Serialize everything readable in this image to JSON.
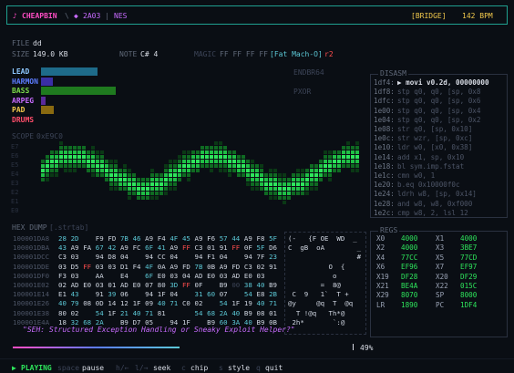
{
  "header": {
    "note_glyph": "♪",
    "app_name": "CHEAPBIN",
    "sep1": "\\",
    "chip_glyph": "◆",
    "chip": "2A03",
    "sep2": "|",
    "system": "NES",
    "mode": "[BRIDGE]",
    "bpm": "142 BPM"
  },
  "file": {
    "file_label": "FILE",
    "file_value": "dd",
    "size_label": "SIZE",
    "size_value": "149.0 KB",
    "note_label": "NOTE",
    "note_value": "C# 4",
    "magic_label": "MAGIC",
    "magic_value": "FF FF FF FF",
    "magic_desc": "[Fat Mach-O]",
    "magic_rev": "r2"
  },
  "channels": [
    {
      "name": "LEAD",
      "color": "#8ec8ff",
      "bar_color": "#1e6b8a",
      "level": 0.62
    },
    {
      "name": "HARMON",
      "color": "#5c7cff",
      "bar_color": "#3a2ea6",
      "level": 0.13
    },
    {
      "name": "BASS",
      "color": "#7cdc4a",
      "bar_color": "#1f7a1f",
      "level": 0.82
    },
    {
      "name": "ARPEG",
      "color": "#c86bff",
      "bar_color": "#5a2a9a",
      "level": 0.05
    },
    {
      "name": "PAD",
      "color": "#f2c94c",
      "bar_color": "#8a6a10",
      "level": 0.14
    },
    {
      "name": "DRUMS",
      "color": "#ff4d6a",
      "bar_color": "#000000",
      "level": 0.0
    }
  ],
  "effects": [
    "ENDBR64",
    "PXOR"
  ],
  "scope": {
    "label": "SCOPE",
    "value": "0xE9C0",
    "lanes": [
      "E7",
      "E6",
      "E5",
      "E4",
      "E3",
      "E2",
      "E1",
      "E0"
    ]
  },
  "disasm": {
    "title": "DISASM",
    "rows": [
      {
        "addr": "1df4:",
        "ins": "▶ movi v0.2d, 00000000",
        "active": true
      },
      {
        "addr": "1df8:",
        "ins": "stp q0, q0, [sp, 0x8",
        "active": false
      },
      {
        "addr": "1dfc:",
        "ins": "stp q0, q0, [sp, 0x6",
        "active": false
      },
      {
        "addr": "1e00:",
        "ins": "stp q0, q0, [sp, 0x4",
        "active": false
      },
      {
        "addr": "1e04:",
        "ins": "stp q0, q0, [sp, 0x2",
        "active": false
      },
      {
        "addr": "1e08:",
        "ins": "str q0, [sp, 0x10]",
        "active": false
      },
      {
        "addr": "1e0c:",
        "ins": "str wzr, [sp, 0xc]",
        "active": false
      },
      {
        "addr": "1e10:",
        "ins": "ldr w0, [x0, 0x38]",
        "active": false
      },
      {
        "addr": "1e14:",
        "ins": "add x1, sp, 0x10",
        "active": false
      },
      {
        "addr": "1e18:",
        "ins": "bl sym.imp.fstat",
        "active": false
      },
      {
        "addr": "1e1c:",
        "ins": "cmn w0, 1",
        "active": false
      },
      {
        "addr": "1e20:",
        "ins": "b.eq 0x10000f0c",
        "active": false
      },
      {
        "addr": "1e24:",
        "ins": "ldrh w8, [sp, 0x14]",
        "active": false
      },
      {
        "addr": "1e28:",
        "ins": "and w8, w8, 0xf000",
        "active": false
      },
      {
        "addr": "1e2c:",
        "ins": "cmp w8, 2, lsl 12",
        "active": false
      }
    ]
  },
  "hexdump": {
    "label": "HEX DUMP",
    "value": "[.strtab]",
    "rows": [
      {
        "addr": "100001DA8",
        "bytes": [
          "28",
          "2D",
          "",
          "F9",
          "FD",
          "7B",
          "46",
          "A9",
          "F4",
          "4F",
          "45",
          "A9",
          "F6",
          "57",
          "44",
          "A9",
          "F8",
          "5F"
        ],
        "ascii": "(-   {F OE  WD  _"
      },
      {
        "addr": "100001DBA",
        "bytes": [
          "43",
          "A9",
          "FA",
          "67",
          "42",
          "A9",
          "FC",
          "6F",
          "41",
          "A9",
          "FF",
          "C3",
          "01",
          "91",
          "FF",
          "0F",
          "5F",
          "D6"
        ],
        "ascii": "C  gB  oA        _"
      },
      {
        "addr": "100001DCC",
        "bytes": [
          "C3",
          "03",
          "",
          "94",
          "D8",
          "04",
          "",
          "94",
          "CC",
          "04",
          "",
          "94",
          "F1",
          "04",
          "",
          "94",
          "7F",
          "23"
        ],
        "ascii": "                 #"
      },
      {
        "addr": "100001DDE",
        "bytes": [
          "03",
          "D5",
          "FF",
          "03",
          "03",
          "D1",
          "F4",
          "4F",
          "0A",
          "A9",
          "FD",
          "7B",
          "0B",
          "A9",
          "FD",
          "C3",
          "02",
          "91"
        ],
        "ascii": "          O  {"
      },
      {
        "addr": "100001DF0",
        "bytes": [
          "F3",
          "03",
          "",
          "AA",
          "",
          "E4",
          "",
          "6F",
          "E0",
          "03",
          "04",
          "AD",
          "E0",
          "03",
          "AD",
          "E0",
          "03"
        ],
        "ascii": "           o"
      },
      {
        "addr": "100001E02",
        "bytes": [
          "02",
          "AD",
          "E0",
          "03",
          "01",
          "AD",
          "E0",
          "07",
          "80",
          "3D",
          "FF",
          "0F",
          "",
          "B9",
          "00",
          "38",
          "40",
          "B9"
        ],
        "ascii": "        =  8@"
      },
      {
        "addr": "100001E14",
        "bytes": [
          "E1",
          "43",
          "",
          "91",
          "39",
          "06",
          "",
          "94",
          "1F",
          "04",
          "",
          "31",
          "60",
          "07",
          "",
          "54",
          "E8",
          "2B"
        ],
        "ascii": " C  9   1`  T +"
      },
      {
        "addr": "100001E26",
        "bytes": [
          "40",
          "79",
          "08",
          "0D",
          "14",
          "12",
          "1F",
          "09",
          "40",
          "71",
          "C0",
          "02",
          "",
          "54",
          "1F",
          "19",
          "40",
          "71"
        ],
        "ascii": "@y     @q  T  @q"
      },
      {
        "addr": "100001E38",
        "bytes": [
          "80",
          "02",
          "",
          "54",
          "1F",
          "21",
          "40",
          "71",
          "81",
          "",
          "",
          "54",
          "68",
          "2A",
          "40",
          "B9",
          "08",
          "01"
        ],
        "ascii": "  T !@q   Th*@"
      },
      {
        "addr": "100001E4A",
        "bytes": [
          "18",
          "32",
          "68",
          "2A",
          "",
          "B9",
          "D7",
          "05",
          "",
          "94",
          "1F",
          "",
          "B9",
          "60",
          "3A",
          "40",
          "B9",
          "0B"
        ],
        "ascii": " 2h*       `:@"
      }
    ]
  },
  "regs": {
    "title": "REGS",
    "rows": [
      [
        {
          "name": "X0",
          "value": "4000"
        },
        {
          "name": "X1",
          "value": "4000"
        }
      ],
      [
        {
          "name": "X2",
          "value": "4000"
        },
        {
          "name": "X3",
          "value": "3BE7"
        }
      ],
      [
        {
          "name": "X4",
          "value": "77CC"
        },
        {
          "name": "X5",
          "value": "77CD"
        }
      ],
      [
        {
          "name": "X6",
          "value": "EF96"
        },
        {
          "name": "X7",
          "value": "EF97"
        }
      ],
      [
        {
          "name": "X19",
          "value": "DF28"
        },
        {
          "name": "X20",
          "value": "DF29"
        }
      ],
      [
        {
          "name": "X21",
          "value": "BE4A"
        },
        {
          "name": "X22",
          "value": "015C"
        }
      ],
      [
        {
          "name": "X29",
          "value": "8070"
        },
        {
          "name": "SP",
          "value": "8000"
        }
      ],
      [
        {
          "name": "LR",
          "value": "1890"
        },
        {
          "name": "PC",
          "value": "1DF4"
        }
      ]
    ]
  },
  "lyric": "\"SEH: Structured Exception Handling or Sneaky Exploit Helper?\"",
  "progress": {
    "value": 0.49,
    "label": "49%"
  },
  "footer": {
    "state_glyph": "▶",
    "state": "PLAYING",
    "hints": [
      {
        "key": "space",
        "action": "pause"
      },
      {
        "key": "h/←",
        "action": ""
      },
      {
        "key": "l/→",
        "action": "seek"
      },
      {
        "key": "c",
        "action": "chip"
      },
      {
        "key": "s",
        "action": "style"
      },
      {
        "key": "q",
        "action": "quit"
      }
    ]
  }
}
